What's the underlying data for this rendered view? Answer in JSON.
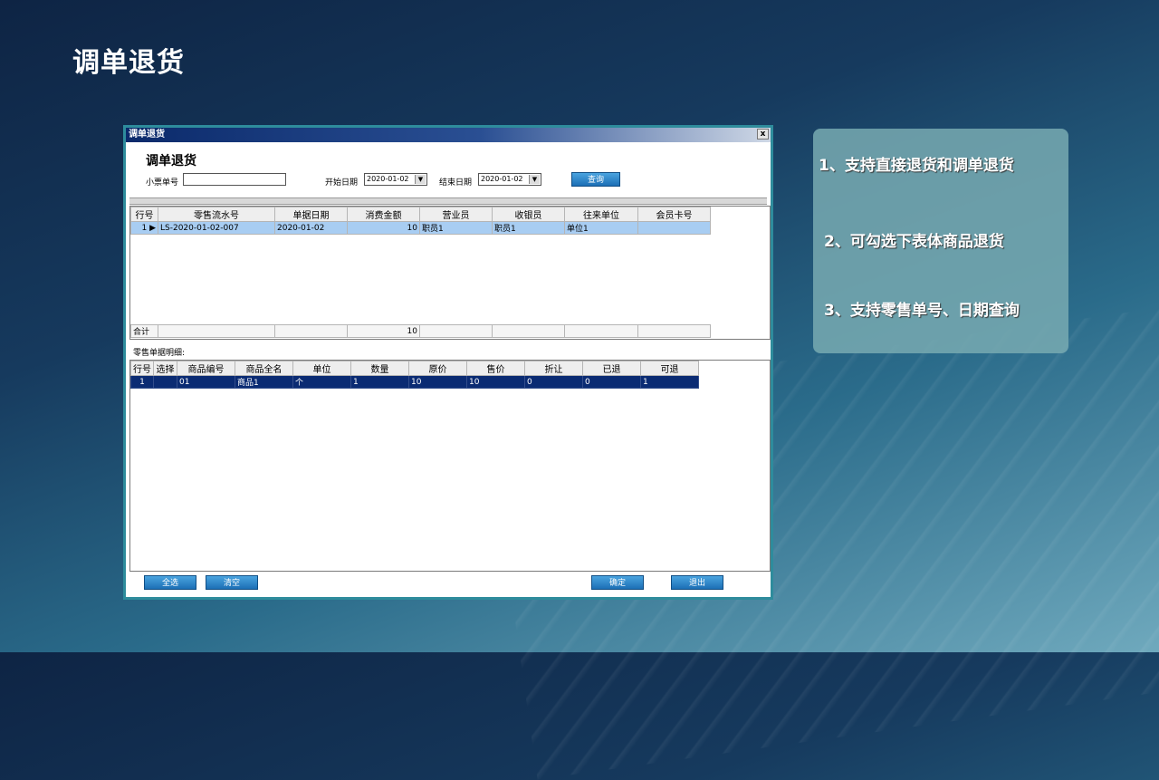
{
  "slide": {
    "title": "调单退货"
  },
  "window": {
    "title": "调单退货",
    "close_glyph": "x",
    "form_title": "调单退货",
    "receipt_label": "小票单号",
    "receipt_value": "",
    "start_label": "开始日期",
    "start_value": "2020-01-02",
    "end_label": "结束日期",
    "end_value": "2020-01-02",
    "query_label": "查询",
    "detail_label": "零售单据明细:",
    "buttons": {
      "select_all": "全选",
      "clear": "清空",
      "confirm": "确定",
      "exit": "退出"
    }
  },
  "upper_grid": {
    "headers": [
      "行号",
      "零售流水号",
      "单据日期",
      "消费金额",
      "营业员",
      "收银员",
      "往来单位",
      "会员卡号"
    ],
    "rows": [
      [
        "1",
        "LS-2020-01-02-007",
        "2020-01-02",
        "10",
        "职员1",
        "职员1",
        "单位1",
        ""
      ]
    ],
    "total": [
      "合计",
      "",
      "",
      "10",
      "",
      "",
      "",
      ""
    ]
  },
  "lower_grid": {
    "headers": [
      "行号",
      "选择",
      "商品编号",
      "商品全名",
      "单位",
      "数量",
      "原价",
      "售价",
      "折让",
      "已退",
      "可退"
    ],
    "rows": [
      [
        "1",
        "",
        "01",
        "商品1",
        "个",
        "1",
        "10",
        "10",
        "0",
        "0",
        "1"
      ]
    ]
  },
  "notes": [
    "1、支持直接退货和调单退货",
    "2、可勾选下表体商品退货",
    "3、支持零售单号、日期查询"
  ]
}
